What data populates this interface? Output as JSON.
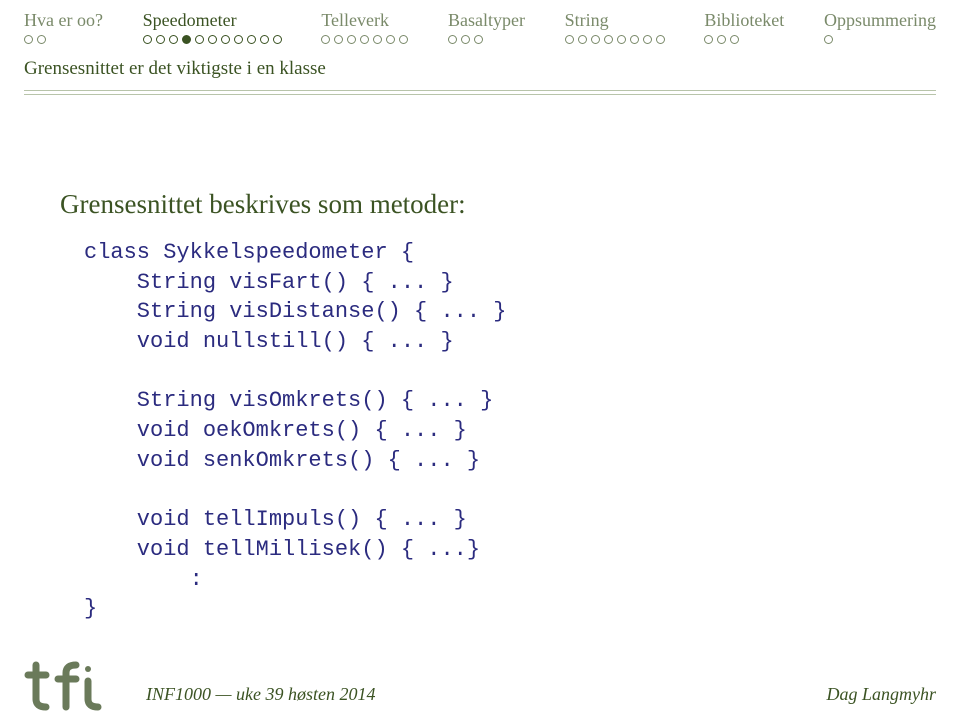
{
  "nav": [
    {
      "label": "Hva er oo?",
      "dots": 2,
      "active": false,
      "filled_index": -1
    },
    {
      "label": "Speedometer",
      "dots": 11,
      "active": true,
      "filled_index": 3
    },
    {
      "label": "Telleverk",
      "dots": 7,
      "active": false,
      "filled_index": -1
    },
    {
      "label": "Basaltyper",
      "dots": 3,
      "active": false,
      "filled_index": -1
    },
    {
      "label": "String",
      "dots": 8,
      "active": false,
      "filled_index": -1
    },
    {
      "label": "Biblioteket",
      "dots": 3,
      "active": false,
      "filled_index": -1
    },
    {
      "label": "Oppsummering",
      "dots": 1,
      "active": false,
      "filled_index": -1
    }
  ],
  "section_title": "Grensesnittet er det viktigste i en klasse",
  "heading": "Grensesnittet beskrives som metoder:",
  "code": "class Sykkelspeedometer {\n    String visFart() { ... }\n    String visDistanse() { ... }\n    void nullstill() { ... }\n\n    String visOmkrets() { ... }\n    void oekOmkrets() { ... }\n    void senkOmkrets() { ... }\n\n    void tellImpuls() { ... }\n    void tellMillisek() { ...}\n        :\n}",
  "footer": {
    "left": "INF1000 — uke 39 høsten 2014",
    "right": "Dag Langmyhr"
  }
}
